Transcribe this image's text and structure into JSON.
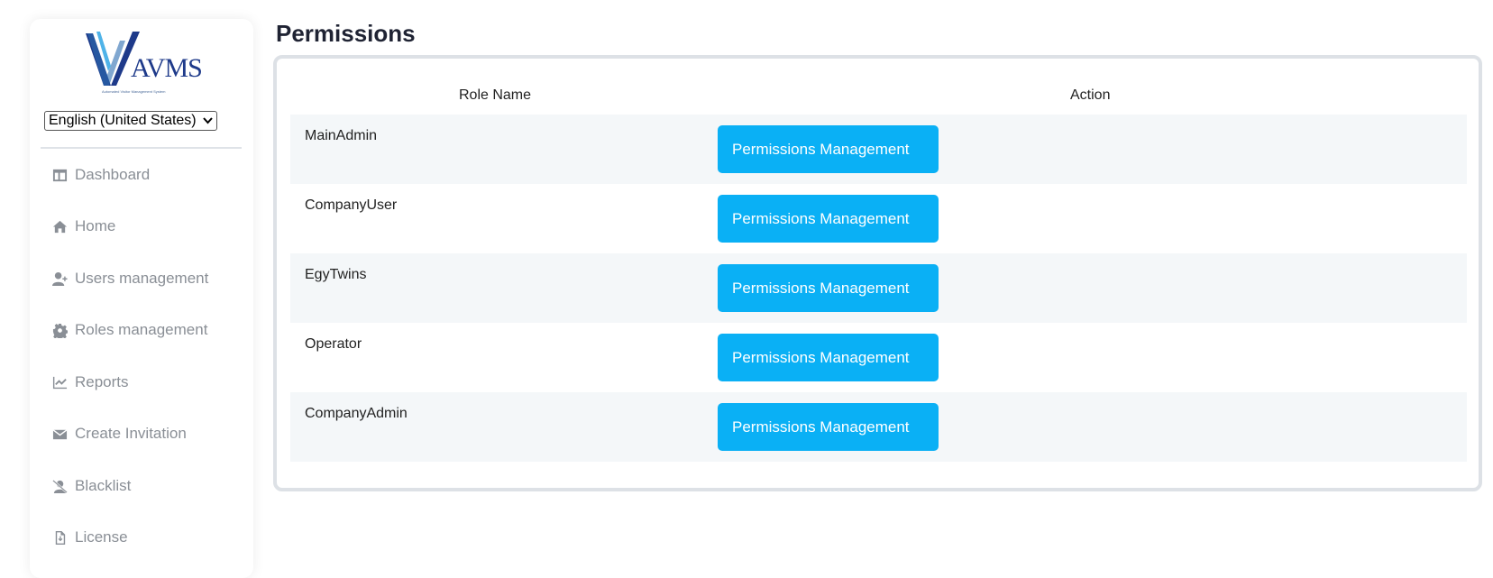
{
  "sidebar": {
    "logo_text": "AVMS",
    "logo_tagline": "Automated Visitor Management System",
    "language_value": "English (United States)",
    "items": [
      {
        "label": "Dashboard",
        "icon": "dashboard-icon"
      },
      {
        "label": "Home",
        "icon": "home-icon"
      },
      {
        "label": "Users management",
        "icon": "user-add-icon"
      },
      {
        "label": "Roles management",
        "icon": "gear-icon"
      },
      {
        "label": "Reports",
        "icon": "chart-line-icon"
      },
      {
        "label": "Create Invitation",
        "icon": "envelope-icon"
      },
      {
        "label": "Blacklist",
        "icon": "user-slash-icon"
      },
      {
        "label": "License",
        "icon": "file-download-icon"
      }
    ]
  },
  "page": {
    "title": "Permissions"
  },
  "table": {
    "headers": {
      "role_name": "Role Name",
      "action": "Action"
    },
    "rows": [
      {
        "role": "MainAdmin",
        "action_label": "Permissions Management"
      },
      {
        "role": "CompanyUser",
        "action_label": "Permissions Management"
      },
      {
        "role": "EgyTwins",
        "action_label": "Permissions Management"
      },
      {
        "role": "Operator",
        "action_label": "Permissions Management"
      },
      {
        "role": "CompanyAdmin",
        "action_label": "Permissions Management"
      }
    ]
  },
  "colors": {
    "accent": "#0ab0f5",
    "row_alt": "#f4f7f9",
    "nav_text": "#8a8f96",
    "logo": "#1e3a8a"
  }
}
